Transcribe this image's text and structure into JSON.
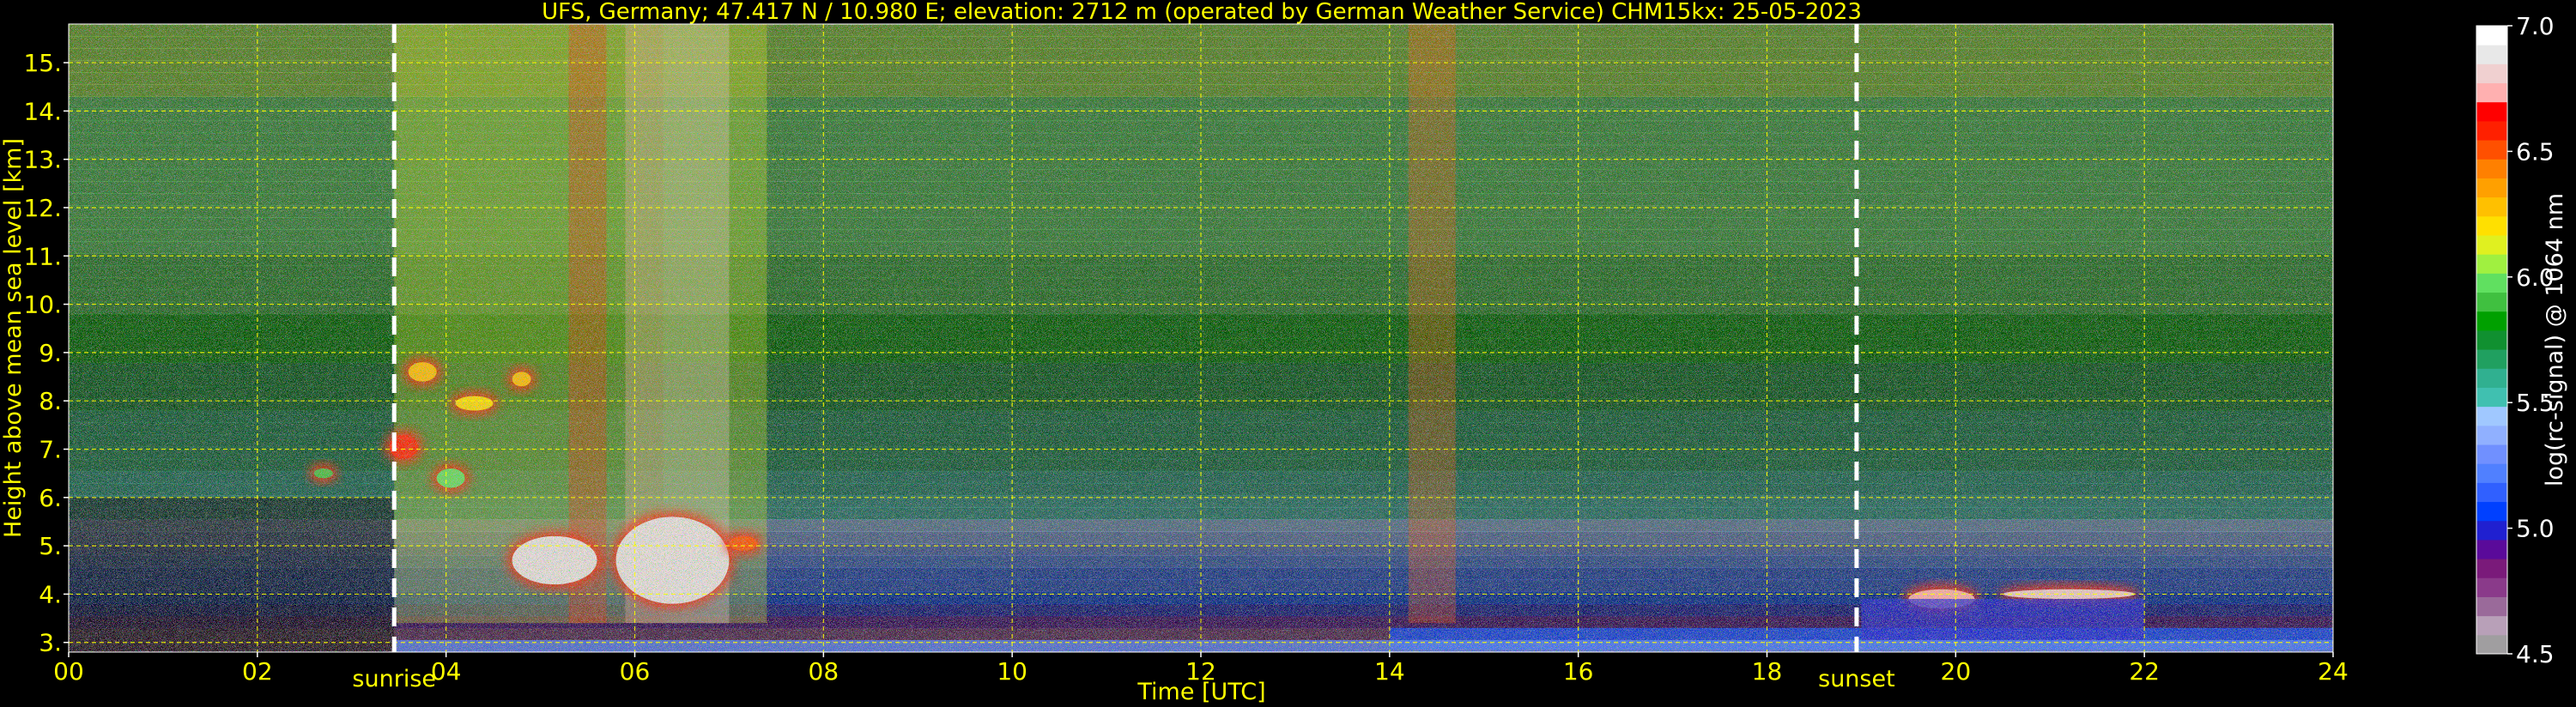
{
  "colors": {
    "background": "#000000",
    "annotation_text": "#ffff00",
    "grid": "#ffff00",
    "white": "#ffffff"
  },
  "chart_data": {
    "type": "heatmap",
    "title": "UFS, Germany; 47.417 N / 10.980 E; elevation: 2712 m  (operated by German Weather Service)    CHM15kx: 25-05-2023",
    "xlabel": "Time [UTC]",
    "ylabel": "Height above mean sea level [km]",
    "xlim": [
      0,
      24
    ],
    "ylim": [
      2.8,
      15.8
    ],
    "x_ticks": [
      "00",
      "02",
      "04",
      "06",
      "08",
      "10",
      "12",
      "14",
      "16",
      "18",
      "20",
      "22",
      "24"
    ],
    "y_ticks": [
      "3.",
      "4.",
      "5.",
      "6.",
      "7.",
      "8.",
      "9.",
      "10.",
      "11.",
      "12.",
      "13.",
      "14.",
      "15."
    ],
    "grid": true,
    "markers": [
      {
        "label": "sunrise",
        "time": 3.45
      },
      {
        "label": "sunset",
        "time": 18.95
      }
    ],
    "colorbar": {
      "label": "log(rc-signal) @ 1064 nm",
      "range": [
        4.5,
        7.0
      ],
      "ticks": [
        "4.5",
        "5.0",
        "5.5",
        "6.0",
        "6.5",
        "7.0"
      ],
      "colors": [
        "#a09ea0",
        "#b8a0b8",
        "#9a6a9a",
        "#8a3a8a",
        "#7a1a7a",
        "#5a0a9a",
        "#2020d0",
        "#0040ff",
        "#3060ff",
        "#5080ff",
        "#7090ff",
        "#90b0ff",
        "#a0c8ff",
        "#40c0b0",
        "#30b090",
        "#20a060",
        "#109030",
        "#00a000",
        "#40c040",
        "#60e060",
        "#a0f040",
        "#e0f020",
        "#ffe000",
        "#ffc000",
        "#ffa000",
        "#ff8000",
        "#ff5000",
        "#ff2000",
        "#ff0000",
        "#ffb0b0",
        "#f0d0d0",
        "#e8e8e8",
        "#ffffff"
      ]
    },
    "features": [
      {
        "kind": "noise-band",
        "t_start": 3.45,
        "t_end": 7.4,
        "z_bottom": 3.4,
        "z_top": 15.8,
        "level": 6.1
      },
      {
        "kind": "noise-band",
        "t_start": 5.3,
        "t_end": 5.7,
        "z_bottom": 3.4,
        "z_top": 15.8,
        "level": 6.6
      },
      {
        "kind": "noise-band",
        "t_start": 5.9,
        "t_end": 6.3,
        "z_bottom": 3.4,
        "z_top": 15.8,
        "level": 6.7
      },
      {
        "kind": "noise-band",
        "t_start": 6.3,
        "t_end": 7.0,
        "z_bottom": 3.4,
        "z_top": 15.8,
        "level": 6.8
      },
      {
        "kind": "noise-band",
        "t_start": 14.2,
        "t_end": 14.7,
        "z_bottom": 3.4,
        "z_top": 15.8,
        "level": 6.5
      },
      {
        "kind": "cloud",
        "t_start": 4.7,
        "t_end": 5.6,
        "z_bottom": 4.2,
        "z_top": 5.2,
        "level": 6.9
      },
      {
        "kind": "cloud",
        "t_start": 5.8,
        "t_end": 7.0,
        "z_bottom": 3.8,
        "z_top": 5.6,
        "level": 6.9
      },
      {
        "kind": "cloud",
        "t_start": 7.0,
        "t_end": 7.3,
        "z_bottom": 4.9,
        "z_top": 5.2,
        "level": 6.5
      },
      {
        "kind": "cloud",
        "t_start": 3.4,
        "t_end": 3.7,
        "z_bottom": 6.8,
        "z_top": 7.3,
        "level": 6.6
      },
      {
        "kind": "cloud",
        "t_start": 3.6,
        "t_end": 3.9,
        "z_bottom": 8.4,
        "z_top": 8.8,
        "level": 6.3
      },
      {
        "kind": "cloud",
        "t_start": 3.9,
        "t_end": 4.2,
        "z_bottom": 6.2,
        "z_top": 6.6,
        "level": 6.0
      },
      {
        "kind": "cloud",
        "t_start": 4.1,
        "t_end": 4.5,
        "z_bottom": 7.8,
        "z_top": 8.1,
        "level": 6.2
      },
      {
        "kind": "cloud",
        "t_start": 4.7,
        "t_end": 4.9,
        "z_bottom": 8.3,
        "z_top": 8.6,
        "level": 6.3
      },
      {
        "kind": "cloud",
        "t_start": 2.6,
        "t_end": 2.8,
        "z_bottom": 6.4,
        "z_top": 6.6,
        "level": 5.9
      },
      {
        "kind": "cloud",
        "t_start": 19.5,
        "t_end": 20.2,
        "z_bottom": 3.7,
        "z_top": 4.1,
        "level": 6.7
      },
      {
        "kind": "cloud",
        "t_start": 20.5,
        "t_end": 21.9,
        "z_bottom": 3.9,
        "z_top": 4.1,
        "level": 6.8
      },
      {
        "kind": "boundary-layer",
        "t_start": 14.0,
        "t_end": 24.0,
        "z_bottom": 2.85,
        "z_top": 3.3,
        "level": 5.1
      },
      {
        "kind": "boundary-layer",
        "t_start": 19.0,
        "t_end": 22.0,
        "z_bottom": 3.0,
        "z_top": 3.9,
        "level": 5.0
      },
      {
        "kind": "surface",
        "t_start": 3.45,
        "t_end": 24.0,
        "z_bottom": 2.8,
        "z_top": 3.05,
        "level": 5.2
      }
    ]
  }
}
